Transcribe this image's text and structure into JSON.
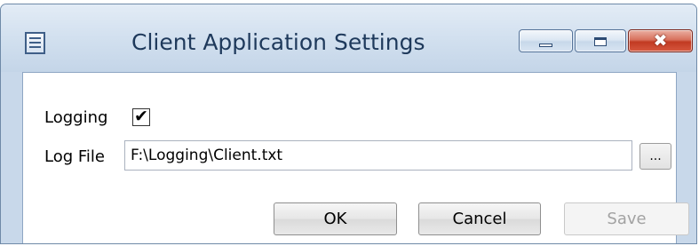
{
  "window": {
    "title": "Client Application Settings",
    "icon": "app-window-icon",
    "controls": {
      "minimize_icon": "minimize-icon",
      "maximize_icon": "maximize-icon",
      "close_glyph": "✖"
    }
  },
  "form": {
    "logging_label": "Logging",
    "logging_checked": true,
    "logging_check_glyph": "✔",
    "logfile_label": "Log File",
    "logfile_value": "F:\\Logging\\Client.txt",
    "browse_label": "..."
  },
  "buttons": {
    "ok_label": "OK",
    "cancel_label": "Cancel",
    "save_label": "Save",
    "save_enabled": false
  },
  "colors": {
    "title_text": "#1e395b",
    "close_button": "#c23a22",
    "disabled_text": "#a2a2a2"
  }
}
